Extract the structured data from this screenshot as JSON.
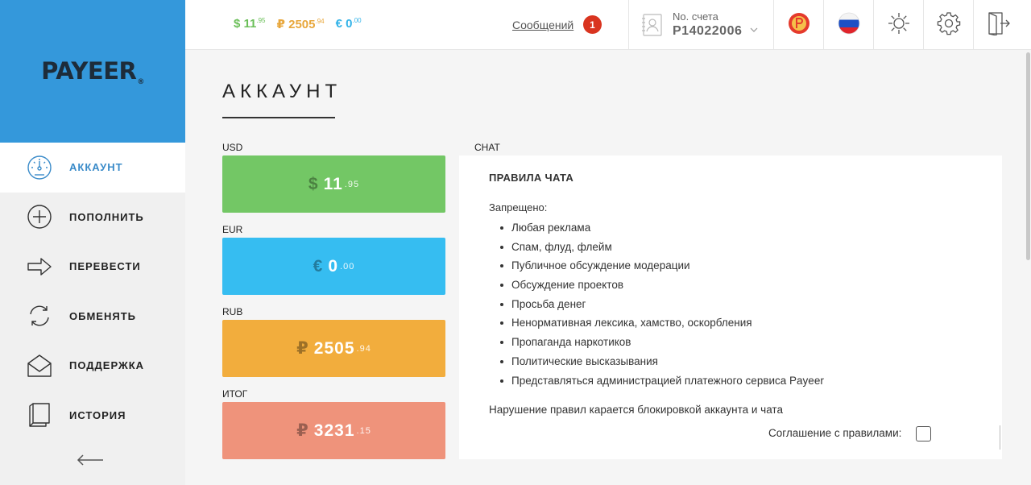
{
  "brand": {
    "logo": "PAYEER",
    "logo_mark": "®"
  },
  "nav": [
    {
      "label": "АККАУНТ",
      "icon": "speedometer-icon",
      "active": true
    },
    {
      "label": "ПОПОЛНИТЬ",
      "icon": "plus-circle-icon",
      "active": false
    },
    {
      "label": "ПЕРЕВЕСТИ",
      "icon": "arrow-right-icon",
      "active": false
    },
    {
      "label": "ОБМЕНЯТЬ",
      "icon": "exchange-icon",
      "active": false
    },
    {
      "label": "ПОДДЕРЖКА",
      "icon": "envelope-icon",
      "active": false
    },
    {
      "label": "ИСТОРИЯ",
      "icon": "book-icon",
      "active": false
    }
  ],
  "topbar": {
    "balances": [
      {
        "symbol": "$",
        "int": "11",
        "frac": ".95",
        "color": "#6bbf59"
      },
      {
        "symbol": "₽",
        "int": "2505",
        "frac": ".94",
        "color": "#e8a73c"
      },
      {
        "symbol": "€",
        "int": "0",
        "frac": ".00",
        "color": "#33b3e8"
      }
    ],
    "messages_label": "Сообщений",
    "messages_count": "1",
    "account_label": "No. счета",
    "account_number": "P14022006"
  },
  "page": {
    "title": "АККАУНТ"
  },
  "wallets": [
    {
      "label": "USD",
      "symbol": "$",
      "int": "11",
      "frac": ".95",
      "color": "#73c765"
    },
    {
      "label": "EUR",
      "symbol": "€",
      "int": "0",
      "frac": ".00",
      "color": "#36bdf1"
    },
    {
      "label": "RUB",
      "symbol": "₽",
      "int": "2505",
      "frac": ".94",
      "color": "#f2ad3d"
    },
    {
      "label": "ИТОГ",
      "symbol": "₽",
      "int": "3231",
      "frac": ".15",
      "color": "#ef937b"
    }
  ],
  "chat": {
    "label": "CHAT",
    "title": "ПРАВИЛА ЧАТА",
    "forbidden": "Запрещено:",
    "rules": [
      "Любая реклама",
      "Спам, флуд, флейм",
      "Публичное обсуждение модерации",
      "Обсуждение проектов",
      "Просьба денег",
      "Ненормативная лексика, хамство, оскорбления",
      "Пропаганда наркотиков",
      "Политические высказывания",
      "Представляться администрацией платежного сервиса Payeer"
    ],
    "violation": "Нарушение правил карается блокировкой аккаунта и чата",
    "agreement": "Соглашение с правилами:"
  }
}
